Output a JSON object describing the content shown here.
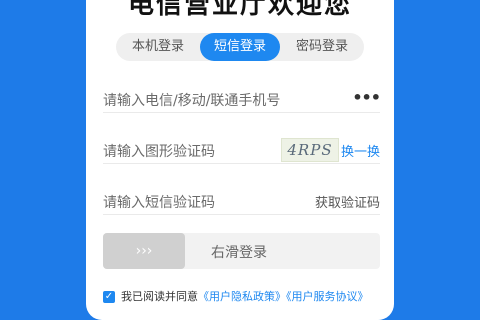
{
  "header": {
    "title": "电信营业厅欢迎您"
  },
  "tabs": [
    {
      "label": "本机登录",
      "active": false
    },
    {
      "label": "短信登录",
      "active": true
    },
    {
      "label": "密码登录",
      "active": false
    }
  ],
  "phone": {
    "placeholder": "请输入电信/移动/联通手机号",
    "more_icon": "•••"
  },
  "captcha": {
    "placeholder": "请输入图形验证码",
    "image_text": "4RPS",
    "refresh_label": "换一换"
  },
  "sms": {
    "placeholder": "请输入短信验证码",
    "get_code_label": "获取验证码"
  },
  "slider": {
    "handle_label": "›››",
    "text": "右滑登录"
  },
  "agreement": {
    "prefix": "我已阅读并同意",
    "privacy": "《用户隐私政策》",
    "service": "《用户服务协议》"
  },
  "colors": {
    "primary": "#1e88f0",
    "background": "#1e7be8"
  }
}
